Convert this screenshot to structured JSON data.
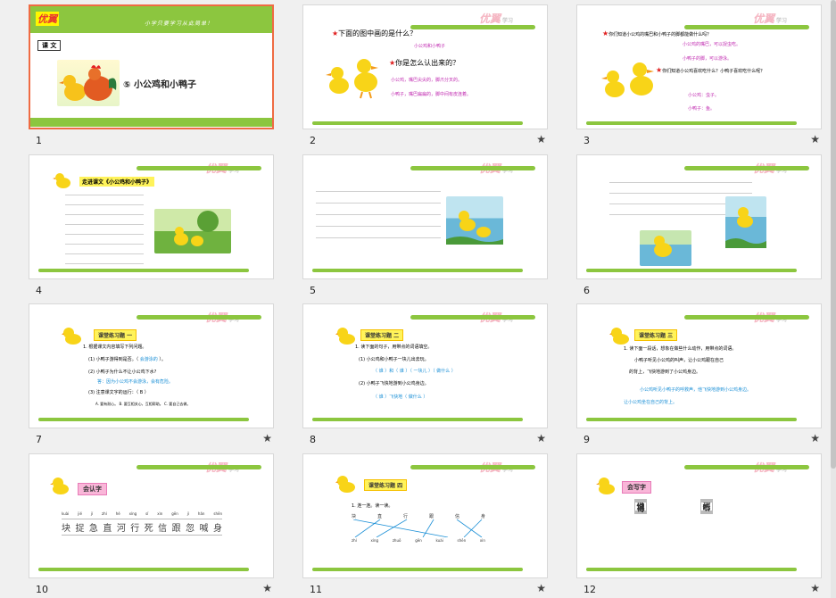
{
  "slides": [
    {
      "num": "1",
      "logo": "优翼",
      "header_slogan": "小学只要学习从此简单！",
      "tag": "课 文",
      "title": "⑤ 小公鸡和小鸭子"
    },
    {
      "num": "2",
      "logo": "优翼",
      "q1": "下面的图中画的是什么？",
      "a1": "小公鸡和小鸭子",
      "q2": "你是怎么认出来的？",
      "a2": "小公鸡，嘴巴尖尖的，脚爪分叉的。",
      "a3": "小鸭子，嘴巴扁扁的，脚中间有皮连着。"
    },
    {
      "num": "3",
      "logo": "优翼",
      "q1": "你们知道小公鸡的嘴巴和小鸭子的脚都能做什么吗？",
      "a1": "小公鸡的嘴巴，可以捉虫吃。",
      "a2": "小鸭子的脚，可以游泳。",
      "q2": "你们知道小公鸡喜欢吃什么？小鸭子喜欢吃什么呢？",
      "a3": "小公鸡：虫子。",
      "a4": "小鸭子：鱼。"
    },
    {
      "num": "4",
      "logo": "优翼",
      "heading": "走进课文《小公鸡和小鸭子》"
    },
    {
      "num": "5",
      "logo": "优翼"
    },
    {
      "num": "6",
      "logo": "优翼"
    },
    {
      "num": "7",
      "logo": "优翼",
      "box": "课堂练习题 一",
      "l1": "1. 根据课文内容填写下列问题。",
      "l2": "(1) 小鸭子游得到是否。（",
      "l2b": "会游泳的",
      "l3": "(2) 小鸭子为什么不让小公鸡下水?",
      "l4": "答：因为小公鸡不会游泳，会有危险。",
      "l5": "(3) 注意课文字的运行：（ B ）",
      "l6": "A. 要有耐心。 B. 要互相关心，互相帮助。 C. 要自己去做。"
    },
    {
      "num": "8",
      "logo": "优翼",
      "box": "课堂练习题 二",
      "l1": "1. 读下面的句子，用带点的词语填空。",
      "l2": "(1) 小公鸡和小鸭子一块儿出去玩。",
      "l3": "（ 谁 ）和（ 谁 ）（ 一块儿 ）（ 做什么 ）",
      "l4": "(2) 小鸭子飞快地游到小公鸡身边。",
      "l5": "（ 谁 ）飞快地（ 做什么 ）"
    },
    {
      "num": "9",
      "logo": "优翼",
      "box": "课堂练习题 三",
      "l1": "1. 读下面一段话，想象在做些什么动作，用带点的词语。",
      "l2": "小鸭子听见小公鸡的叫声，让小公鸡跟在自己",
      "l3": "的背上，飞快地游到了小公鸡身边。",
      "l4": "小公鸡听见小鸭子的呼救声，他飞快地游到小公鸡身边。",
      "l5": "让小公鸡坐在自己的背上。"
    },
    {
      "num": "10",
      "logo": "优翼",
      "box": "会认字",
      "pinyin": [
        "kuài",
        "jié",
        "jí",
        "zhí",
        "hé",
        "xíng",
        "sǐ",
        "xìn",
        "gēn",
        "jí",
        "hǎn",
        "shēn"
      ],
      "chars": [
        "块",
        "捉",
        "急",
        "直",
        "河",
        "行",
        "死",
        "信",
        "跟",
        "忽",
        "喊",
        "身"
      ]
    },
    {
      "num": "11",
      "logo": "优翼",
      "box": "课堂练习题 四",
      "l1": "1. 连一连。读一读。",
      "top": [
        "块",
        "直",
        "行",
        "跟",
        "信",
        "身"
      ],
      "bottom": [
        "zhí",
        "xíng",
        "zhuō",
        "gēn",
        "kuài",
        "shēn",
        "xìn"
      ]
    },
    {
      "num": "12",
      "logo": "优翼",
      "box": "会写字",
      "left": [
        "他",
        "说",
        "地",
        "哥"
      ],
      "right": [
        "河",
        "也",
        "听"
      ]
    }
  ],
  "icons": {
    "animation": "star-icon"
  }
}
